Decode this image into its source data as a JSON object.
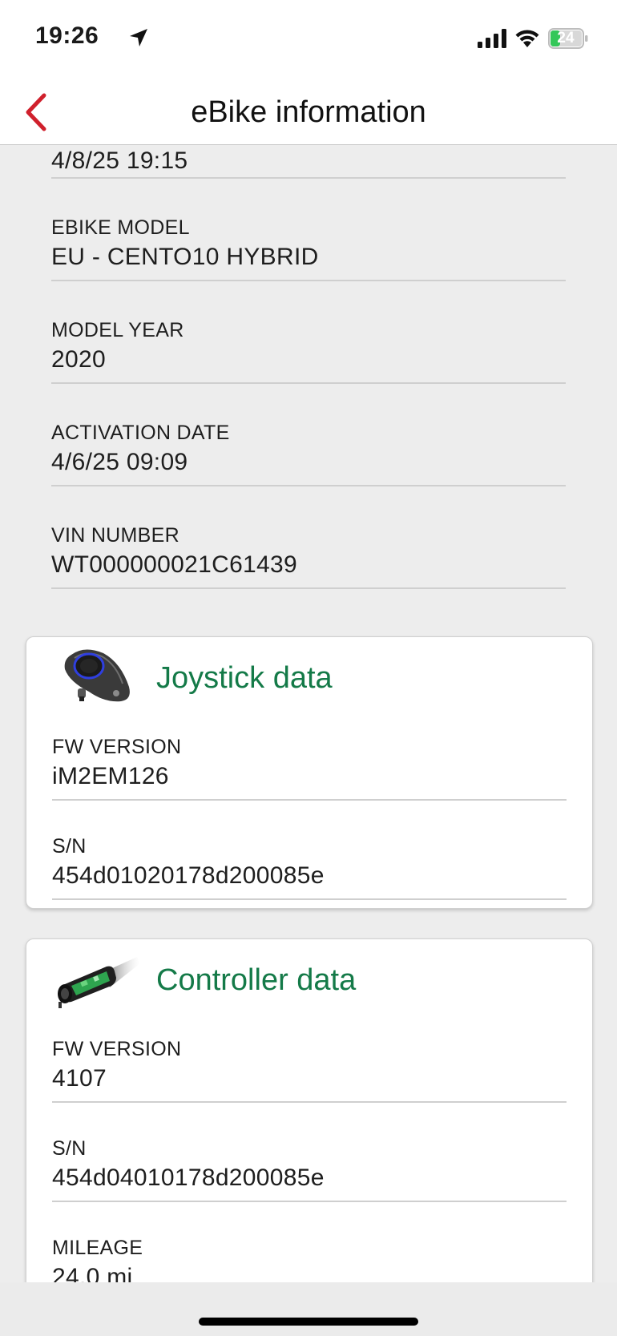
{
  "status_bar": {
    "time": "19:26",
    "battery": "24"
  },
  "nav": {
    "title": "eBike information"
  },
  "bike_fields": [
    {
      "label": "",
      "value": "4/8/25 19:15"
    },
    {
      "label": "EBIKE MODEL",
      "value": "EU - CENTO10 HYBRID"
    },
    {
      "label": "MODEL YEAR",
      "value": "2020"
    },
    {
      "label": "ACTIVATION DATE",
      "value": "4/6/25 09:09"
    },
    {
      "label": "VIN NUMBER",
      "value": "WT000000021C61439"
    }
  ],
  "joystick": {
    "title": "Joystick data",
    "fields": [
      {
        "label": "FW VERSION",
        "value": "iM2EM126"
      },
      {
        "label": "S/N",
        "value": "454d01020178d200085e"
      }
    ]
  },
  "controller": {
    "title": "Controller data",
    "fields": [
      {
        "label": "FW VERSION",
        "value": "4107"
      },
      {
        "label": "S/N",
        "value": "454d04010178d200085e"
      },
      {
        "label": "MILEAGE",
        "value": "24.0 mi"
      }
    ]
  },
  "colors": {
    "accent_red": "#d0202c",
    "title_green": "#147a48",
    "battery_green": "#34c759"
  }
}
